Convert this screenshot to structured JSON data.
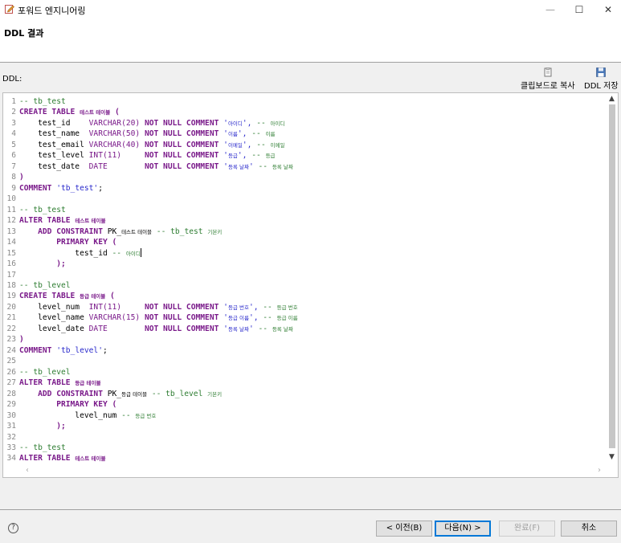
{
  "window": {
    "title": "포워드 엔지니어링",
    "minimize": "—",
    "maximize": "☐",
    "close": "✕"
  },
  "header": {
    "heading": "DDL 결과"
  },
  "panel": {
    "ddl_label": "DDL:",
    "copy_button": "클립보드로 복사",
    "save_button": "DDL 저장"
  },
  "editor": {
    "lines": [
      [
        {
          "t": "-- tb_test",
          "c": "comment"
        }
      ],
      [
        {
          "t": "CREATE TABLE ",
          "c": "kw"
        },
        {
          "t": "테스트 테이블",
          "c": "kr kw"
        },
        {
          "t": " (",
          "c": "kw"
        }
      ],
      [
        {
          "t": "    test_id    ",
          "c": "plain"
        },
        {
          "t": "VARCHAR(20) ",
          "c": "type"
        },
        {
          "t": "NOT NULL COMMENT ",
          "c": "kw"
        },
        {
          "t": "'",
          "c": "str"
        },
        {
          "t": "아이디",
          "c": "kr str"
        },
        {
          "t": "', ",
          "c": "str"
        },
        {
          "t": "-- ",
          "c": "comment"
        },
        {
          "t": "아이디",
          "c": "kr comment"
        }
      ],
      [
        {
          "t": "    test_name  ",
          "c": "plain"
        },
        {
          "t": "VARCHAR(50) ",
          "c": "type"
        },
        {
          "t": "NOT NULL COMMENT ",
          "c": "kw"
        },
        {
          "t": "'",
          "c": "str"
        },
        {
          "t": "이름",
          "c": "kr str"
        },
        {
          "t": "', ",
          "c": "str"
        },
        {
          "t": "-- ",
          "c": "comment"
        },
        {
          "t": "이름",
          "c": "kr comment"
        }
      ],
      [
        {
          "t": "    test_email ",
          "c": "plain"
        },
        {
          "t": "VARCHAR(40) ",
          "c": "type"
        },
        {
          "t": "NOT NULL COMMENT ",
          "c": "kw"
        },
        {
          "t": "'",
          "c": "str"
        },
        {
          "t": "이메일",
          "c": "kr str"
        },
        {
          "t": "', ",
          "c": "str"
        },
        {
          "t": "-- ",
          "c": "comment"
        },
        {
          "t": "이메일",
          "c": "kr comment"
        }
      ],
      [
        {
          "t": "    test_level ",
          "c": "plain"
        },
        {
          "t": "INT(11)     ",
          "c": "type"
        },
        {
          "t": "NOT NULL COMMENT ",
          "c": "kw"
        },
        {
          "t": "'",
          "c": "str"
        },
        {
          "t": "등급",
          "c": "kr str"
        },
        {
          "t": "', ",
          "c": "str"
        },
        {
          "t": "-- ",
          "c": "comment"
        },
        {
          "t": "등급",
          "c": "kr comment"
        }
      ],
      [
        {
          "t": "    test_date  ",
          "c": "plain"
        },
        {
          "t": "DATE        ",
          "c": "type"
        },
        {
          "t": "NOT NULL COMMENT ",
          "c": "kw"
        },
        {
          "t": "'",
          "c": "str"
        },
        {
          "t": "등록 날짜",
          "c": "kr str"
        },
        {
          "t": "' ",
          "c": "str"
        },
        {
          "t": "-- ",
          "c": "comment"
        },
        {
          "t": "등록 날짜",
          "c": "kr comment"
        }
      ],
      [
        {
          "t": ")",
          "c": "kw"
        }
      ],
      [
        {
          "t": "COMMENT ",
          "c": "kw"
        },
        {
          "t": "'tb_test'",
          "c": "str"
        },
        {
          "t": ";",
          "c": "plain"
        }
      ],
      [],
      [
        {
          "t": "-- tb_test",
          "c": "comment"
        }
      ],
      [
        {
          "t": "ALTER TABLE ",
          "c": "kw"
        },
        {
          "t": "테스트 테이블",
          "c": "kr kw"
        }
      ],
      [
        {
          "t": "    ADD CONSTRAINT ",
          "c": "kw"
        },
        {
          "t": "PK_",
          "c": "plain"
        },
        {
          "t": "테스트 테이블",
          "c": "kr plain"
        },
        {
          "t": " -- tb_test ",
          "c": "comment"
        },
        {
          "t": "기본키",
          "c": "kr comment"
        }
      ],
      [
        {
          "t": "        PRIMARY KEY (",
          "c": "kw"
        }
      ],
      [
        {
          "t": "            test_id ",
          "c": "plain"
        },
        {
          "t": "-- ",
          "c": "comment"
        },
        {
          "t": "아이디",
          "c": "kr comment"
        },
        {
          "t": "",
          "c": "caret"
        }
      ],
      [
        {
          "t": "        );",
          "c": "kw"
        }
      ],
      [],
      [
        {
          "t": "-- tb_level",
          "c": "comment"
        }
      ],
      [
        {
          "t": "CREATE TABLE ",
          "c": "kw"
        },
        {
          "t": "등급 테이블",
          "c": "kr kw"
        },
        {
          "t": " (",
          "c": "kw"
        }
      ],
      [
        {
          "t": "    level_num  ",
          "c": "plain"
        },
        {
          "t": "INT(11)     ",
          "c": "type"
        },
        {
          "t": "NOT NULL COMMENT ",
          "c": "kw"
        },
        {
          "t": "'",
          "c": "str"
        },
        {
          "t": "등급 번호",
          "c": "kr str"
        },
        {
          "t": "', ",
          "c": "str"
        },
        {
          "t": "-- ",
          "c": "comment"
        },
        {
          "t": "등급 번호",
          "c": "kr comment"
        }
      ],
      [
        {
          "t": "    level_name ",
          "c": "plain"
        },
        {
          "t": "VARCHAR(15) ",
          "c": "type"
        },
        {
          "t": "NOT NULL COMMENT ",
          "c": "kw"
        },
        {
          "t": "'",
          "c": "str"
        },
        {
          "t": "등급 이름",
          "c": "kr str"
        },
        {
          "t": "', ",
          "c": "str"
        },
        {
          "t": "-- ",
          "c": "comment"
        },
        {
          "t": "등급 이름",
          "c": "kr comment"
        }
      ],
      [
        {
          "t": "    level_date ",
          "c": "plain"
        },
        {
          "t": "DATE        ",
          "c": "type"
        },
        {
          "t": "NOT NULL COMMENT ",
          "c": "kw"
        },
        {
          "t": "'",
          "c": "str"
        },
        {
          "t": "등록 날짜",
          "c": "kr str"
        },
        {
          "t": "' ",
          "c": "str"
        },
        {
          "t": "-- ",
          "c": "comment"
        },
        {
          "t": "등록 날짜",
          "c": "kr comment"
        }
      ],
      [
        {
          "t": ")",
          "c": "kw"
        }
      ],
      [
        {
          "t": "COMMENT ",
          "c": "kw"
        },
        {
          "t": "'tb_level'",
          "c": "str"
        },
        {
          "t": ";",
          "c": "plain"
        }
      ],
      [],
      [
        {
          "t": "-- tb_level",
          "c": "comment"
        }
      ],
      [
        {
          "t": "ALTER TABLE ",
          "c": "kw"
        },
        {
          "t": "등급 테이블",
          "c": "kr kw"
        }
      ],
      [
        {
          "t": "    ADD CONSTRAINT ",
          "c": "kw"
        },
        {
          "t": "PK_",
          "c": "plain"
        },
        {
          "t": "등급 테이블",
          "c": "kr plain"
        },
        {
          "t": " -- tb_level ",
          "c": "comment"
        },
        {
          "t": "기본키",
          "c": "kr comment"
        }
      ],
      [
        {
          "t": "        PRIMARY KEY (",
          "c": "kw"
        }
      ],
      [
        {
          "t": "            level_num ",
          "c": "plain"
        },
        {
          "t": "-- ",
          "c": "comment"
        },
        {
          "t": "등급 번호",
          "c": "kr comment"
        }
      ],
      [
        {
          "t": "        );",
          "c": "kw"
        }
      ],
      [],
      [
        {
          "t": "-- tb_test",
          "c": "comment"
        }
      ],
      [
        {
          "t": "ALTER TABLE ",
          "c": "kw"
        },
        {
          "t": "테스트 테이블",
          "c": "kr kw"
        }
      ]
    ]
  },
  "footer": {
    "help_icon": "?",
    "back_button": "< 이전(B)",
    "next_button": "다음(N) >",
    "finish_button": "완료(F)",
    "cancel_button": "취소"
  },
  "icons": {
    "app": "pencil-form-icon",
    "copy": "clipboard-icon",
    "save": "floppy-disk-icon",
    "help": "question-circle-icon"
  },
  "colors": {
    "comment": "#2e7d32",
    "keyword": "#7a1a8a",
    "string": "#2a2acc",
    "primary_button_border": "#0078d7"
  }
}
